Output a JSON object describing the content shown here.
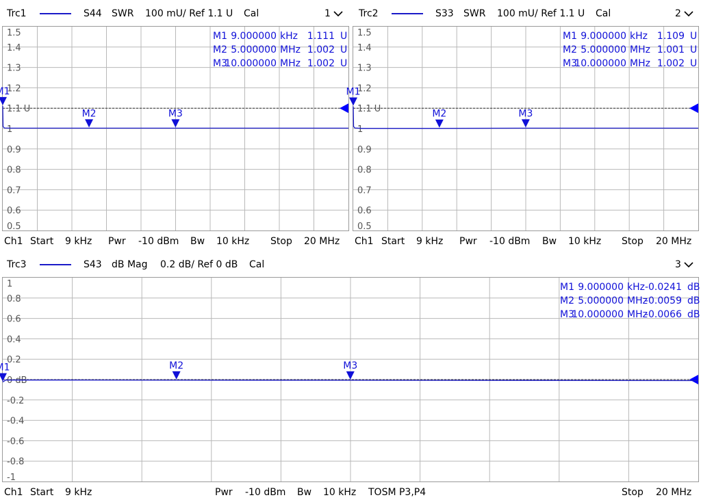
{
  "panels": [
    {
      "id": 1,
      "trace": "Trc1",
      "param": "S44",
      "format": "SWR",
      "scale": "100 mU/ Ref 1.1 U",
      "cal": "Cal",
      "window_num": "1",
      "ref_label": "1.1 U",
      "yticks": [
        "1.5",
        "1.4",
        "1.3",
        "1.2",
        "",
        "1",
        "0.9",
        "0.8",
        "0.7",
        "0.6",
        "0.5"
      ],
      "markers": [
        {
          "name": "M1",
          "stim": "9.000000",
          "unit": "kHz",
          "value": "1.111",
          "vunit": "U"
        },
        {
          "name": "M2",
          "stim": "5.000000",
          "unit": "MHz",
          "value": "1.002",
          "vunit": "U"
        },
        {
          "name": "M3",
          "stim": "10.000000",
          "unit": "MHz",
          "value": "1.002",
          "vunit": "U"
        }
      ],
      "footer": {
        "ch": "Ch1",
        "start_label": "Start",
        "start": "9 kHz",
        "pwr_label": "Pwr",
        "pwr": "-10 dBm",
        "bw_label": "Bw",
        "bw": "10 kHz",
        "stop_label": "Stop",
        "stop": "20 MHz"
      }
    },
    {
      "id": 2,
      "trace": "Trc2",
      "param": "S33",
      "format": "SWR",
      "scale": "100 mU/ Ref 1.1 U",
      "cal": "Cal",
      "window_num": "2",
      "ref_label": "1.1 U",
      "yticks": [
        "1.5",
        "1.4",
        "1.3",
        "1.2",
        "",
        "1",
        "0.9",
        "0.8",
        "0.7",
        "0.6",
        "0.5"
      ],
      "markers": [
        {
          "name": "M1",
          "stim": "9.000000",
          "unit": "kHz",
          "value": "1.109",
          "vunit": "U"
        },
        {
          "name": "M2",
          "stim": "5.000000",
          "unit": "MHz",
          "value": "1.001",
          "vunit": "U"
        },
        {
          "name": "M3",
          "stim": "10.000000",
          "unit": "MHz",
          "value": "1.002",
          "vunit": "U"
        }
      ],
      "footer": {
        "ch": "Ch1",
        "start_label": "Start",
        "start": "9 kHz",
        "pwr_label": "Pwr",
        "pwr": "-10 dBm",
        "bw_label": "Bw",
        "bw": "10 kHz",
        "stop_label": "Stop",
        "stop": "20 MHz"
      }
    },
    {
      "id": 3,
      "trace": "Trc3",
      "param": "S43",
      "format": "dB Mag",
      "scale": "0.2 dB/ Ref 0 dB",
      "cal": "Cal",
      "window_num": "3",
      "ref_label": "0 dB",
      "yticks": [
        "1",
        "0.8",
        "0.6",
        "0.4",
        "0.2",
        "",
        "-0.2",
        "-0.4",
        "-0.6",
        "-0.8",
        "-1"
      ],
      "markers": [
        {
          "name": "M1",
          "stim": "9.000000",
          "unit": "kHz",
          "value": "-0.0241",
          "vunit": "dB"
        },
        {
          "name": "M2",
          "stim": "5.000000",
          "unit": "MHz",
          "value": "-0.0059",
          "vunit": "dB"
        },
        {
          "name": "M3",
          "stim": "10.000000",
          "unit": "MHz",
          "value": "-0.0066",
          "vunit": "dB"
        }
      ],
      "footer": {
        "ch": "Ch1",
        "start_label": "Start",
        "start": "9 kHz",
        "pwr_label": "Pwr",
        "pwr": "-10 dBm",
        "bw_label": "Bw",
        "bw": "10 kHz",
        "cal": "TOSM P3,P4",
        "stop_label": "Stop",
        "stop": "20 MHz"
      }
    }
  ],
  "colors": {
    "trace": "#1a1ac8",
    "marker": "#1010d8",
    "grid": "#b8b8b8",
    "border": "#9a9a9a",
    "ref_arrow": "#0000ff"
  },
  "chart_data": [
    {
      "type": "line",
      "title": "Trc1 S44 SWR",
      "x_unit": "Hz",
      "xlim": [
        9000,
        20000000
      ],
      "ylim": [
        0.5,
        1.5
      ],
      "reference": 1.1,
      "grid": true,
      "series": [
        {
          "name": "S44",
          "x": [
            9000,
            30000,
            100000,
            500000,
            2000000,
            5000000,
            10000000,
            15000000,
            20000000
          ],
          "values": [
            1.111,
            1.01,
            1.003,
            1.002,
            1.002,
            1.002,
            1.002,
            1.002,
            1.002
          ]
        }
      ],
      "markers": [
        {
          "name": "M1",
          "x": 9000,
          "y": 1.111
        },
        {
          "name": "M2",
          "x": 5000000,
          "y": 1.002
        },
        {
          "name": "M3",
          "x": 10000000,
          "y": 1.002
        }
      ]
    },
    {
      "type": "line",
      "title": "Trc2 S33 SWR",
      "x_unit": "Hz",
      "xlim": [
        9000,
        20000000
      ],
      "ylim": [
        0.5,
        1.5
      ],
      "reference": 1.1,
      "grid": true,
      "series": [
        {
          "name": "S33",
          "x": [
            9000,
            30000,
            100000,
            500000,
            2000000,
            5000000,
            10000000,
            15000000,
            20000000
          ],
          "values": [
            1.109,
            1.01,
            1.003,
            1.001,
            1.001,
            1.001,
            1.002,
            1.002,
            1.002
          ]
        }
      ],
      "markers": [
        {
          "name": "M1",
          "x": 9000,
          "y": 1.109
        },
        {
          "name": "M2",
          "x": 5000000,
          "y": 1.001
        },
        {
          "name": "M3",
          "x": 10000000,
          "y": 1.002
        }
      ]
    },
    {
      "type": "line",
      "title": "Trc3 S43 dB Mag",
      "x_unit": "Hz",
      "xlim": [
        9000,
        20000000
      ],
      "ylim": [
        -1,
        1
      ],
      "reference": 0,
      "grid": true,
      "series": [
        {
          "name": "S43",
          "x": [
            9000,
            100000,
            2000000,
            5000000,
            10000000,
            15000000,
            20000000
          ],
          "values": [
            -0.0241,
            -0.004,
            -0.005,
            -0.0059,
            -0.0066,
            -0.008,
            -0.01
          ]
        }
      ],
      "markers": [
        {
          "name": "M1",
          "x": 9000,
          "y": -0.0241
        },
        {
          "name": "M2",
          "x": 5000000,
          "y": -0.0059
        },
        {
          "name": "M3",
          "x": 10000000,
          "y": -0.0066
        }
      ]
    }
  ]
}
